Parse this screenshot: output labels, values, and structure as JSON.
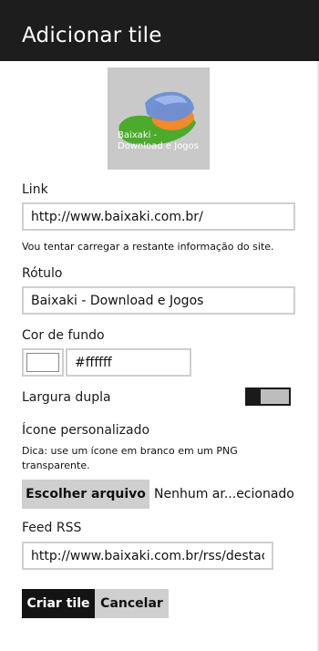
{
  "header": {
    "title": "Adicionar tile"
  },
  "tile_preview": {
    "label": "Baixaki - Download e Jogos",
    "background": "#c9c9c9"
  },
  "link": {
    "label": "Link",
    "value": "http://www.baixaki.com.br/",
    "hint": "Vou tentar carregar a restante informação do site."
  },
  "rotulo": {
    "label": "Rótulo",
    "value": "Baixaki - Download e Jogos"
  },
  "cor_de_fundo": {
    "label": "Cor de fundo",
    "value": "#ffffff",
    "swatch_color": "#ffffff"
  },
  "largura_dupla": {
    "label": "Largura dupla",
    "enabled": false
  },
  "icone": {
    "label": "Ícone personalizado",
    "hint": "Dica: use um ícone em branco em um PNG transparente.",
    "button_label": "Escolher arquivo",
    "status": "Nenhum ar...ecionado"
  },
  "feed_rss": {
    "label": "Feed RSS",
    "value": "http://www.baixaki.com.br/rss/destac"
  },
  "actions": {
    "create_label": "Criar tile",
    "cancel_label": "Cancelar"
  }
}
